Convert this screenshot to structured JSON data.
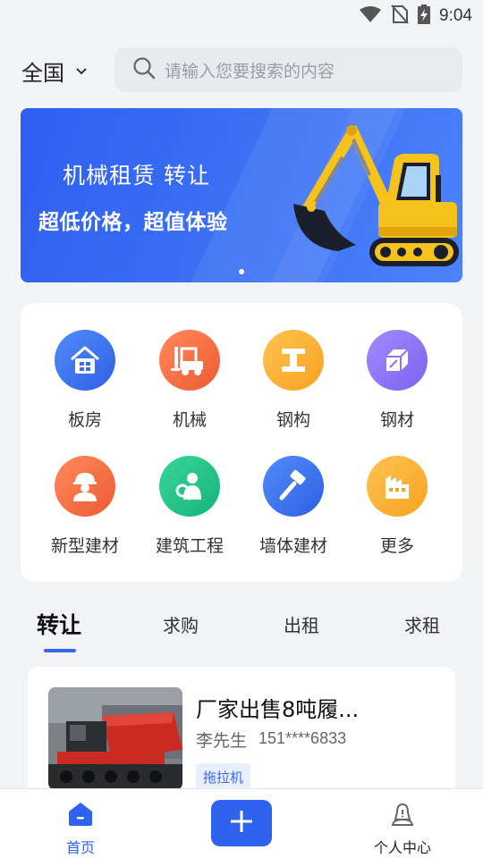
{
  "status_bar": {
    "time": "9:04",
    "icons": [
      "wifi-icon",
      "no-sim-icon",
      "battery-charging-icon"
    ]
  },
  "header": {
    "region": "全国",
    "search_placeholder": "请输入您要搜索的内容"
  },
  "banner": {
    "title": "机械租赁 转让",
    "subtitle": "超低价格，超值体验",
    "page_count": 1,
    "active_page": 1
  },
  "categories": [
    {
      "label": "板房",
      "icon": "house-icon",
      "color_from": "#4f8df8",
      "color_to": "#2f5fe8"
    },
    {
      "label": "机械",
      "icon": "forklift-icon",
      "color_from": "#ff8a5c",
      "color_to": "#ef5a32"
    },
    {
      "label": "钢构",
      "icon": "steel-beam-icon",
      "color_from": "#ffc353",
      "color_to": "#f7a21e"
    },
    {
      "label": "钢材",
      "icon": "steel-material-icon",
      "color_from": "#a28bff",
      "color_to": "#7b62f0"
    },
    {
      "label": "新型建材",
      "icon": "worker-icon",
      "color_from": "#ff8a5c",
      "color_to": "#ef5a32"
    },
    {
      "label": "建筑工程",
      "icon": "engineer-icon",
      "color_from": "#3bd49a",
      "color_to": "#14b57a"
    },
    {
      "label": "墙体建材",
      "icon": "hammer-icon",
      "color_from": "#4f8df8",
      "color_to": "#2f5fe8"
    },
    {
      "label": "更多",
      "icon": "more-icon",
      "color_from": "#ffc353",
      "color_to": "#f7a21e"
    }
  ],
  "tabs": [
    {
      "label": "转让",
      "active": true
    },
    {
      "label": "求购",
      "active": false
    },
    {
      "label": "出租",
      "active": false
    },
    {
      "label": "求租",
      "active": false
    }
  ],
  "listings": [
    {
      "title": "厂家出售8吨履...",
      "seller": "李先生",
      "phone": "151****6833",
      "tag": "拖拉机"
    }
  ],
  "bottom_nav": {
    "home_label": "首页",
    "profile_label": "个人中心"
  },
  "colors": {
    "accent": "#2f62ee",
    "background": "#f2f3f5"
  }
}
